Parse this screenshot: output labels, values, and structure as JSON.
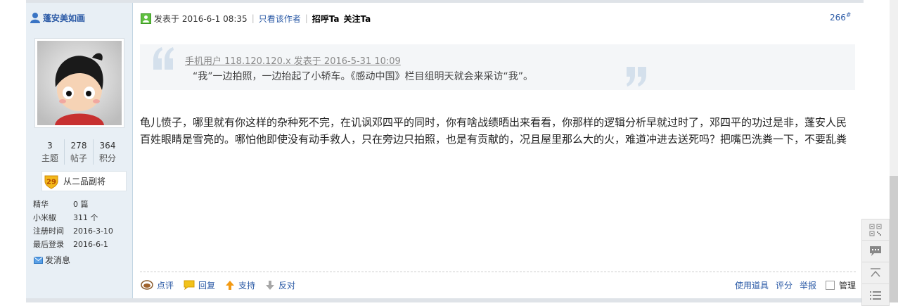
{
  "user": {
    "name": "蓬安美如画",
    "stats": [
      {
        "value": "3",
        "label": "主题"
      },
      {
        "value": "278",
        "label": "帖子"
      },
      {
        "value": "364",
        "label": "积分"
      }
    ],
    "rank_level": "29",
    "rank_title": "从二品副将",
    "info": [
      {
        "key": "精华",
        "value": "0 篇"
      },
      {
        "key": "小米椒",
        "value": "311 个"
      },
      {
        "key": "注册时间",
        "value": "2016-3-10"
      },
      {
        "key": "最后登录",
        "value": "2016-6-1"
      }
    ],
    "message_label": "发消息"
  },
  "post": {
    "time": "发表于 2016-6-1 08:35",
    "only_author": "只看该作者",
    "greet": "招呼Ta",
    "follow": "关注Ta",
    "floor": "266",
    "floor_mark": "#",
    "quote_header": "手机用户 118.120.120.x 发表于 2016-5-31 10:09",
    "quote_text": "“我”一边拍照，一边抬起了小轿车。《感动中国》栏目组明天就会来采访“我”。",
    "content": "龟儿愤子，哪里就有你这样的杂种死不完，在讥讽邓四平的同时，你有啥战绩晒出来看看，你那样的逻辑分析早就过时了，邓四平的功过是非，蓬安人民百姓眼睛是雪亮的。哪怕他即使没有动手救人，只在旁边只拍照，也是有贡献的，况且屋里那么大的火，难道冲进去送死吗？把嘴巴洗粪一下，不要乱粪"
  },
  "actions": {
    "comment": "点评",
    "reply": "回复",
    "support": "支持",
    "oppose": "反对",
    "use_tool": "使用道具",
    "rate": "评分",
    "report": "举报",
    "manage": "管理"
  },
  "colors": {
    "link": "#2b5aa6",
    "sidebar_bg": "#e8eff5",
    "quote_bg": "#f4f6f8"
  }
}
